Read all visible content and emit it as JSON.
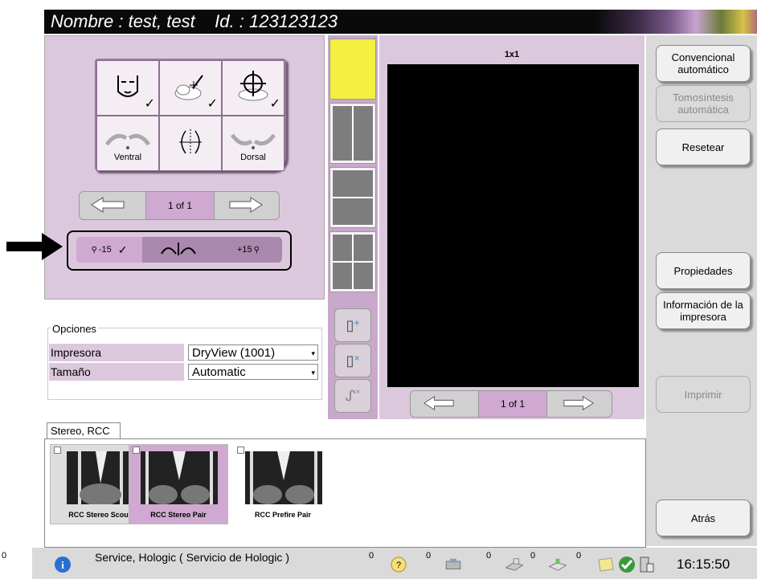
{
  "header": {
    "title": "Nombre : test, test    Id. : 123123123"
  },
  "tools": [
    {
      "icon": "face-icon",
      "label": ""
    },
    {
      "icon": "cloud-pencil-icon",
      "label": ""
    },
    {
      "icon": "target-crosshair-icon",
      "label": ""
    },
    {
      "icon": "ventral-breast-icon",
      "label": "Ventral"
    },
    {
      "icon": "symmetry-icon",
      "label": ""
    },
    {
      "icon": "dorsal-breast-icon",
      "label": "Dorsal"
    }
  ],
  "tool_pager": {
    "label": "1 of 1"
  },
  "angle_buttons": [
    {
      "label": "-15"
    },
    {
      "label": ""
    },
    {
      "label": "+15"
    }
  ],
  "options": {
    "legend": "Opciones",
    "printer_label": "Impresora",
    "printer_value": "DryView (1001)",
    "size_label": "Tamaño",
    "size_value": "Automatic"
  },
  "viewer": {
    "label": "1x1",
    "pager": "1 of 1"
  },
  "right_buttons": {
    "conventional": "Convencional automático",
    "tomo": "Tomosíntesis automática",
    "reset": "Resetear",
    "properties": "Propiedades",
    "printer_info": "Información de la impresora",
    "print": "Imprimir",
    "back": "Atrás"
  },
  "thumbs": {
    "tab": "Stereo, RCC",
    "items": [
      {
        "caption": "RCC Stereo Scout"
      },
      {
        "caption": "RCC Stereo Pair"
      },
      {
        "caption": "RCC Prefire Pair"
      }
    ]
  },
  "status": {
    "left_count": "0",
    "message": "Service, Hologic ( Servicio de Hologic )",
    "counts": [
      "0",
      "0",
      "0",
      "0",
      "0"
    ],
    "time": "16:15:50"
  },
  "colors": {
    "lilac": "#dcc8dc",
    "accent": "#cfa9d1",
    "active_tile": "#f4f040"
  }
}
